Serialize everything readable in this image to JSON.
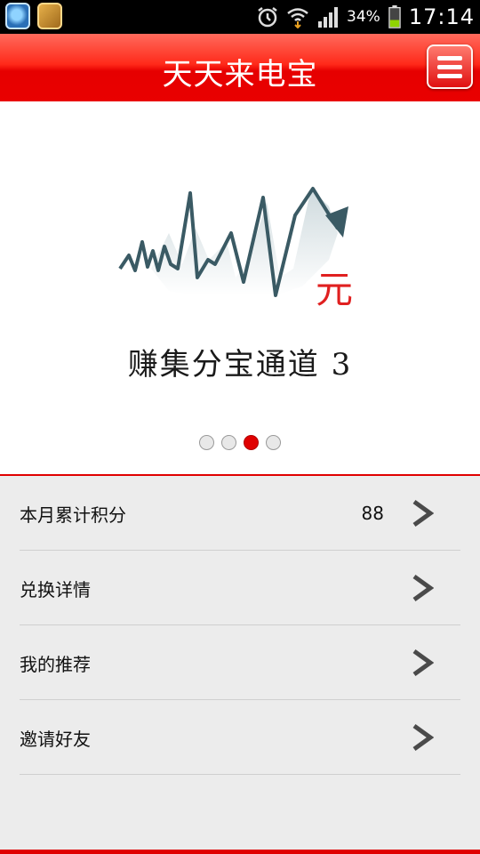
{
  "status_bar": {
    "battery_percent": "34%",
    "time": "17:14",
    "icons": [
      "app-notification-icon",
      "package-notification-icon",
      "alarm-icon",
      "wifi-icon",
      "signal-icon",
      "battery-icon"
    ]
  },
  "header": {
    "title": "天天来电宝",
    "menu_icon": "hamburger-menu-icon"
  },
  "banner": {
    "caption": "赚集分宝通道 3",
    "graphic_text": "元",
    "slides": 4,
    "active_slide": 3
  },
  "menu": {
    "items": [
      {
        "label": "本月累计积分",
        "value": "88"
      },
      {
        "label": "兑换详情",
        "value": ""
      },
      {
        "label": "我的推荐",
        "value": ""
      },
      {
        "label": "邀请好友",
        "value": ""
      }
    ]
  },
  "colors": {
    "accent": "#e60000",
    "background": "#ececec"
  }
}
